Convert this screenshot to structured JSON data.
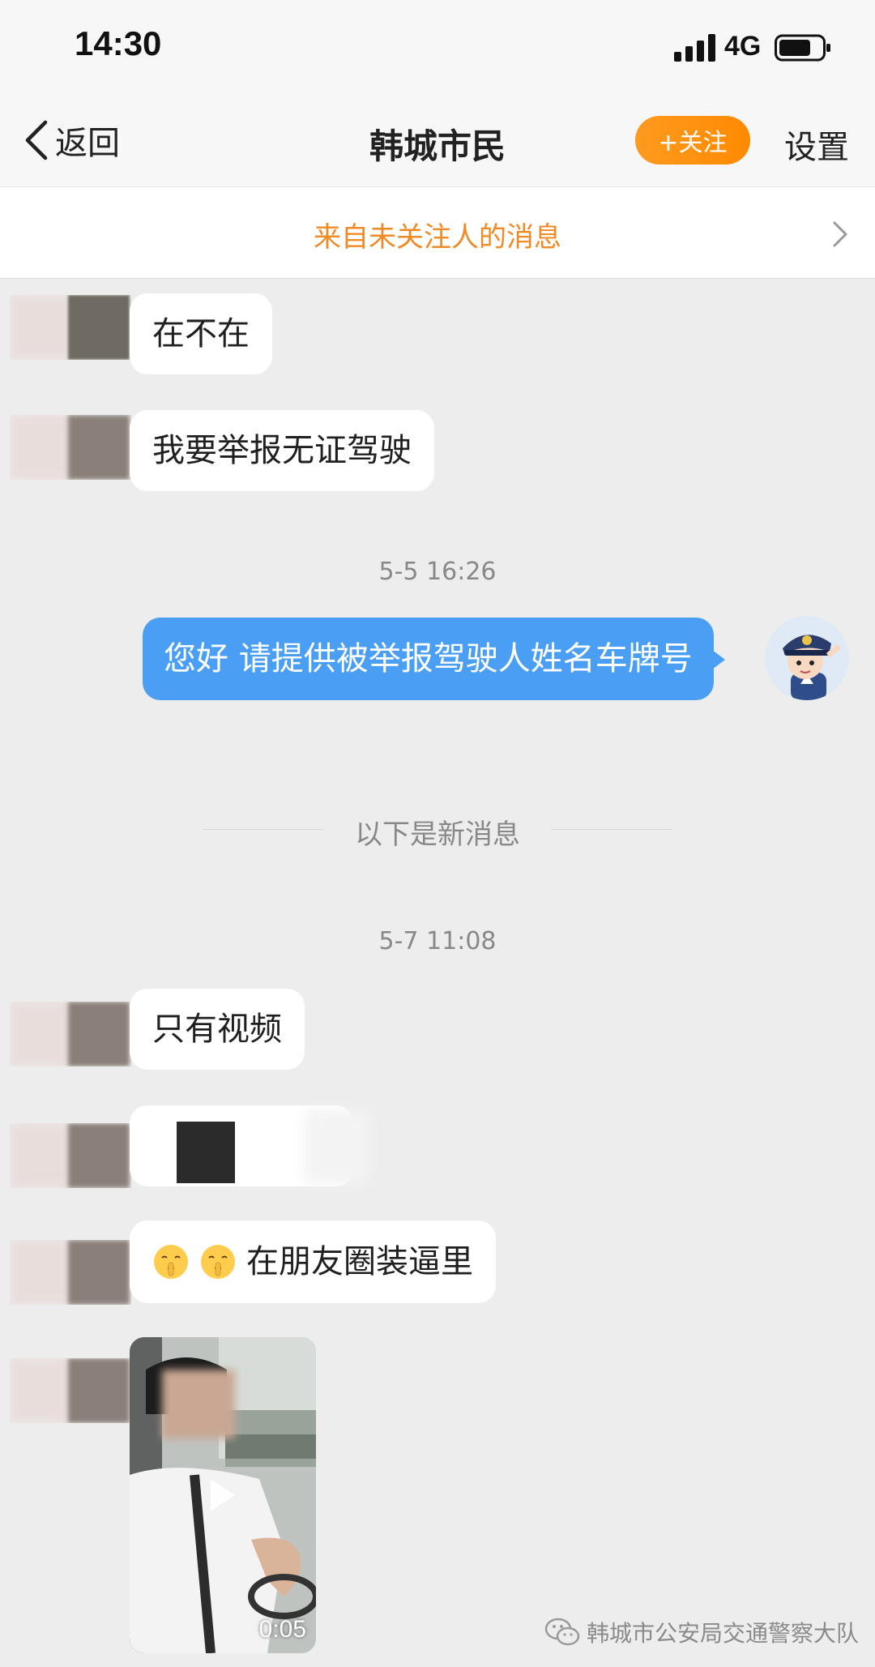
{
  "status_bar": {
    "time": "14:30",
    "network": "4G"
  },
  "nav": {
    "back_label": "返回",
    "title": "韩城市民",
    "follow_label": "+关注",
    "settings_label": "设置"
  },
  "banner": {
    "label": "来自未关注人的消息"
  },
  "messages": {
    "m1": "在不在",
    "m2": "我要举报无证驾驶",
    "ts1": "5-5 16:26",
    "reply": "您好 请提供被举报驾驶人姓名车牌号",
    "new_divider": "以下是新消息",
    "ts2": "5-7 11:08",
    "m3": "只有视频",
    "m5": "在朋友圈装逼里",
    "video_duration": "0:05"
  },
  "watermark": {
    "text": "韩城市公安局交通警察大队"
  },
  "colors": {
    "accent_orange": "#ff8a00",
    "banner_text": "#f08a24",
    "sent_bubble": "#4a9ff5",
    "chat_bg": "#ededed"
  },
  "icons": [
    "signal-icon",
    "battery-icon",
    "back-chevron-icon",
    "chevron-right-icon",
    "police-avatar",
    "shush-emoji-icon",
    "wechat-logo-icon"
  ]
}
